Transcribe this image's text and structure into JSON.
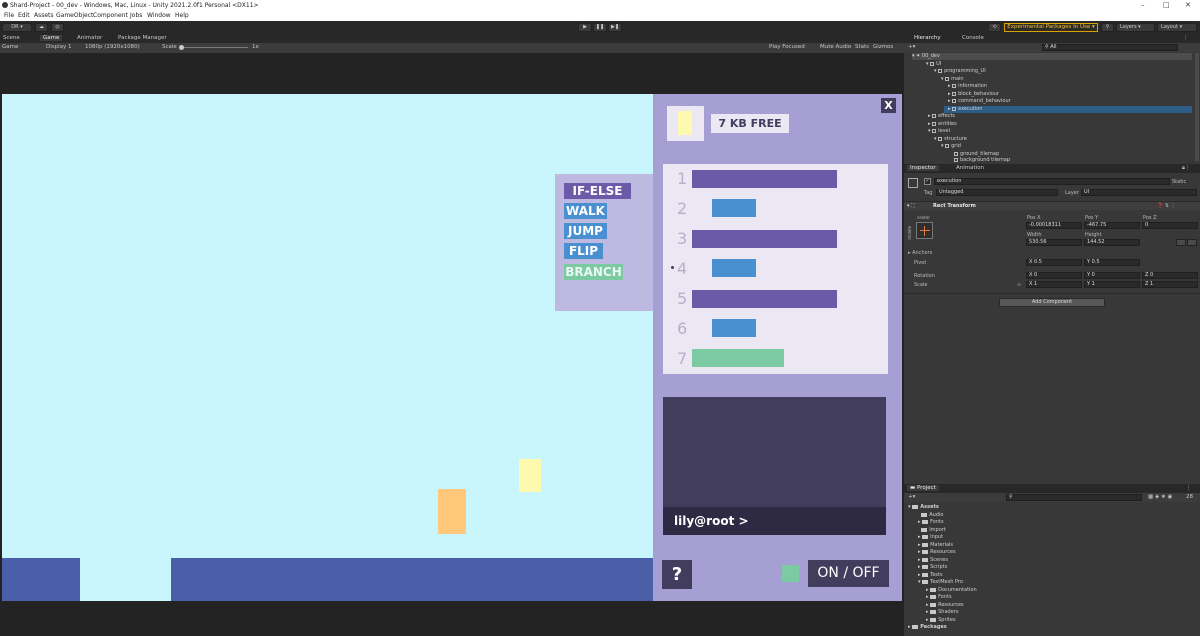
{
  "window": {
    "title": "Shard-Project - 00_dev - Windows, Mac, Linux - Unity 2021.2.0f1 Personal <DX11>",
    "controls": [
      "–",
      "□",
      "✕"
    ]
  },
  "menu": [
    "File",
    "Edit",
    "Assets",
    "GameObject",
    "Component",
    "Jobs",
    "Window",
    "Help"
  ],
  "toolbar": {
    "account": "DR ▾",
    "play_controls": [
      "▶",
      "❚❚",
      "▶❚"
    ],
    "experimental": "Experimental Packages In Use ▾",
    "layers": "Layers",
    "layout": "Layout"
  },
  "game_tabs": {
    "tabs": [
      "Scene",
      "Game",
      "Animator",
      "Package Manager"
    ],
    "display_mode": "Game",
    "display": "Display 1",
    "resolution": "1080p (1920x1080)",
    "scale_label": "Scale",
    "scale_value": "1x",
    "play_focused": "Play Focused",
    "mute_audio": "Mute Audio",
    "stats": "Stats",
    "gizmos": "Gizmos"
  },
  "game": {
    "memory": "7 KB FREE",
    "close": "X",
    "commands": [
      "IF-ELSE",
      "WALK",
      "JUMP",
      "FLIP",
      "BRANCH"
    ],
    "program_lines": [
      "1",
      "2",
      "3",
      "4",
      "5",
      "6",
      "7"
    ],
    "terminal_prompt": "lily@root >",
    "help": "?",
    "power": "ON / OFF",
    "colors": {
      "sky": "#c8f6fc",
      "ground": "#4b5fa8",
      "panel": "#a59fd4",
      "purple_block": "#6a5aa8",
      "blue_block": "#4a8fd0",
      "green_block": "#7ccaa2",
      "orange": "#ffc87a",
      "yellow": "#fdfab0",
      "terminal": "#423c5d"
    }
  },
  "hierarchy": {
    "tabs": [
      "Hierarchy",
      "Console"
    ],
    "search": "All",
    "items": [
      {
        "label": "00_dev",
        "depth": 0
      },
      {
        "label": "UI",
        "depth": 1
      },
      {
        "label": "programming_UI",
        "depth": 2
      },
      {
        "label": "main",
        "depth": 3
      },
      {
        "label": "information",
        "depth": 4
      },
      {
        "label": "block_behaviour",
        "depth": 4
      },
      {
        "label": "command_behaviour",
        "depth": 4
      },
      {
        "label": "execution",
        "depth": 4
      },
      {
        "label": "effects",
        "depth": 1
      },
      {
        "label": "entities",
        "depth": 1
      },
      {
        "label": "level",
        "depth": 1
      },
      {
        "label": "structure",
        "depth": 2
      },
      {
        "label": "grid",
        "depth": 3
      },
      {
        "label": "ground_tilemap",
        "depth": 4
      },
      {
        "label": "background tilemap",
        "depth": 4
      }
    ]
  },
  "inspector": {
    "tabs": [
      "Inspector",
      "Animation"
    ],
    "object_name": "execution",
    "static": "Static",
    "tag_label": "Tag",
    "tag_value": "Untagged",
    "layer_label": "Layer",
    "layer_value": "UI",
    "component": "Rect Transform",
    "anchor_label": "center",
    "anchor_side": "middle",
    "pos_x_label": "Pos X",
    "pos_y_label": "Pos Y",
    "pos_z_label": "Pos Z",
    "pos_x": "-0.00018311",
    "pos_y": "-467.75",
    "pos_z": "0",
    "width_label": "Width",
    "height_label": "Height",
    "width": "530.56",
    "height": "144.52",
    "anchors": "Anchors",
    "pivot_label": "Pivot",
    "pivot_x": "0.5",
    "pivot_y": "0.5",
    "rotation_label": "Rotation",
    "rot_x": "0",
    "rot_y": "0",
    "rot_z": "0",
    "scale_label": "Scale",
    "scale_x": "1",
    "scale_y": "1",
    "scale_z": "1",
    "add_component": "Add Component"
  },
  "project": {
    "tabs": [
      "Project"
    ],
    "count": "28",
    "items": [
      {
        "label": "Assets",
        "depth": 0
      },
      {
        "label": "Audio",
        "depth": 1
      },
      {
        "label": "Fonts",
        "depth": 1
      },
      {
        "label": "Import",
        "depth": 1
      },
      {
        "label": "Input",
        "depth": 1
      },
      {
        "label": "Materials",
        "depth": 1
      },
      {
        "label": "Resources",
        "depth": 1
      },
      {
        "label": "Scenes",
        "depth": 1
      },
      {
        "label": "Scripts",
        "depth": 1
      },
      {
        "label": "Tests",
        "depth": 1
      },
      {
        "label": "TextMesh Pro",
        "depth": 1
      },
      {
        "label": "Documentation",
        "depth": 2
      },
      {
        "label": "Fonts",
        "depth": 2
      },
      {
        "label": "Resources",
        "depth": 2
      },
      {
        "label": "Shaders",
        "depth": 2
      },
      {
        "label": "Sprites",
        "depth": 2
      },
      {
        "label": "Packages",
        "depth": 0
      }
    ]
  }
}
